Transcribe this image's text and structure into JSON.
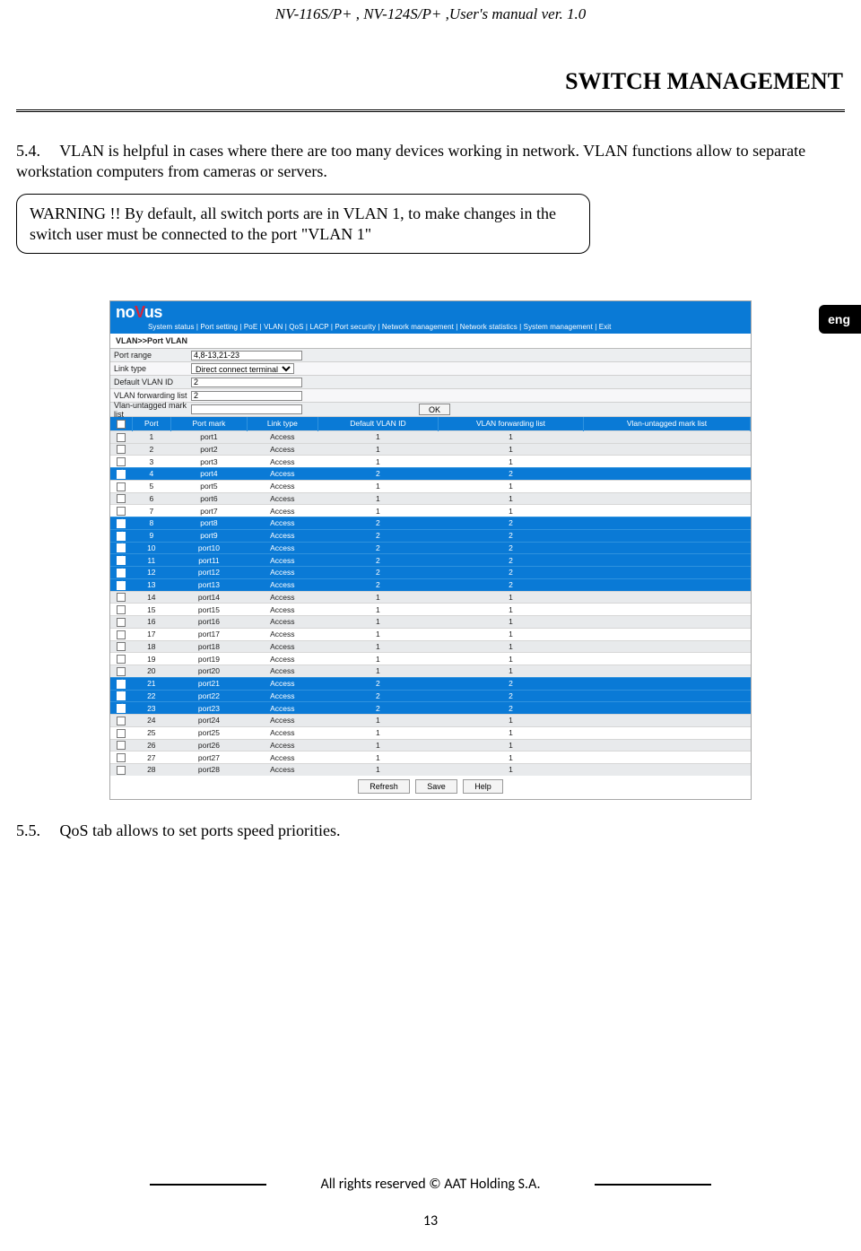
{
  "doc": {
    "header": "NV-116S/P+ , NV-124S/P+ ,User's manual ver. 1.0",
    "section_title": "SWITCH MANAGEMENT",
    "para54_num": "5.4.",
    "para54_text": "VLAN is helpful in cases where there are too many devices working in network. VLAN functions allow to separate workstation computers from cameras or servers.",
    "warning": "WARNING !! By default, all switch ports are in VLAN 1, to make changes in the switch user must be connected to the port \"VLAN 1\"",
    "para55_num": "5.5.",
    "para55_text": "QoS tab allows to set ports speed priorities.",
    "footer": "All rights reserved © AAT Holding S.A.",
    "page_num": "13"
  },
  "lang_tab": "eng",
  "ui": {
    "logo_no": "no",
    "logo_v": "V",
    "logo_us": "us",
    "menu": "System status | Port setting | PoE | VLAN | QoS | LACP | Port security | Network management | Network statistics | System management | Exit",
    "breadcrumb": "VLAN>>Port VLAN",
    "form": {
      "port_range_label": "Port range",
      "port_range_value": "4,8-13,21-23",
      "link_type_label": "Link type",
      "link_type_value": "Direct connect terminal",
      "default_vlan_id_label": "Default VLAN ID",
      "default_vlan_id_value": "2",
      "vlan_fwd_label": "VLAN forwarding list",
      "vlan_fwd_value": "2",
      "untagged_label": "Vlan-untagged mark list",
      "untagged_value": "",
      "ok": "OK"
    },
    "headers": {
      "chk": "",
      "port": "Port",
      "mark": "Port mark",
      "link": "Link type",
      "defvlan": "Default VLAN ID",
      "fwd": "VLAN forwarding list",
      "unt": "Vlan-untagged mark list"
    },
    "rows": [
      {
        "chk": false,
        "sel": false,
        "stripe": "gray",
        "port": "1",
        "mark": "port1",
        "link": "Access",
        "def": "1",
        "fwd": "1",
        "unt": ""
      },
      {
        "chk": false,
        "sel": false,
        "stripe": "gray",
        "port": "2",
        "mark": "port2",
        "link": "Access",
        "def": "1",
        "fwd": "1",
        "unt": ""
      },
      {
        "chk": false,
        "sel": false,
        "stripe": "white",
        "port": "3",
        "mark": "port3",
        "link": "Access",
        "def": "1",
        "fwd": "1",
        "unt": ""
      },
      {
        "chk": true,
        "sel": true,
        "stripe": "blue",
        "port": "4",
        "mark": "port4",
        "link": "Access",
        "def": "2",
        "fwd": "2",
        "unt": ""
      },
      {
        "chk": false,
        "sel": false,
        "stripe": "white",
        "port": "5",
        "mark": "port5",
        "link": "Access",
        "def": "1",
        "fwd": "1",
        "unt": ""
      },
      {
        "chk": false,
        "sel": false,
        "stripe": "gray",
        "port": "6",
        "mark": "port6",
        "link": "Access",
        "def": "1",
        "fwd": "1",
        "unt": ""
      },
      {
        "chk": false,
        "sel": false,
        "stripe": "white",
        "port": "7",
        "mark": "port7",
        "link": "Access",
        "def": "1",
        "fwd": "1",
        "unt": ""
      },
      {
        "chk": true,
        "sel": true,
        "stripe": "blue",
        "port": "8",
        "mark": "port8",
        "link": "Access",
        "def": "2",
        "fwd": "2",
        "unt": ""
      },
      {
        "chk": true,
        "sel": true,
        "stripe": "blue",
        "port": "9",
        "mark": "port9",
        "link": "Access",
        "def": "2",
        "fwd": "2",
        "unt": ""
      },
      {
        "chk": true,
        "sel": true,
        "stripe": "blue",
        "port": "10",
        "mark": "port10",
        "link": "Access",
        "def": "2",
        "fwd": "2",
        "unt": ""
      },
      {
        "chk": true,
        "sel": true,
        "stripe": "blue",
        "port": "11",
        "mark": "port11",
        "link": "Access",
        "def": "2",
        "fwd": "2",
        "unt": ""
      },
      {
        "chk": true,
        "sel": true,
        "stripe": "blue",
        "port": "12",
        "mark": "port12",
        "link": "Access",
        "def": "2",
        "fwd": "2",
        "unt": ""
      },
      {
        "chk": true,
        "sel": true,
        "stripe": "blue",
        "port": "13",
        "mark": "port13",
        "link": "Access",
        "def": "2",
        "fwd": "2",
        "unt": ""
      },
      {
        "chk": false,
        "sel": false,
        "stripe": "gray",
        "port": "14",
        "mark": "port14",
        "link": "Access",
        "def": "1",
        "fwd": "1",
        "unt": ""
      },
      {
        "chk": false,
        "sel": false,
        "stripe": "white",
        "port": "15",
        "mark": "port15",
        "link": "Access",
        "def": "1",
        "fwd": "1",
        "unt": ""
      },
      {
        "chk": false,
        "sel": false,
        "stripe": "gray",
        "port": "16",
        "mark": "port16",
        "link": "Access",
        "def": "1",
        "fwd": "1",
        "unt": ""
      },
      {
        "chk": false,
        "sel": false,
        "stripe": "white",
        "port": "17",
        "mark": "port17",
        "link": "Access",
        "def": "1",
        "fwd": "1",
        "unt": ""
      },
      {
        "chk": false,
        "sel": false,
        "stripe": "gray",
        "port": "18",
        "mark": "port18",
        "link": "Access",
        "def": "1",
        "fwd": "1",
        "unt": ""
      },
      {
        "chk": false,
        "sel": false,
        "stripe": "white",
        "port": "19",
        "mark": "port19",
        "link": "Access",
        "def": "1",
        "fwd": "1",
        "unt": ""
      },
      {
        "chk": false,
        "sel": false,
        "stripe": "gray",
        "port": "20",
        "mark": "port20",
        "link": "Access",
        "def": "1",
        "fwd": "1",
        "unt": ""
      },
      {
        "chk": true,
        "sel": true,
        "stripe": "blue",
        "port": "21",
        "mark": "port21",
        "link": "Access",
        "def": "2",
        "fwd": "2",
        "unt": ""
      },
      {
        "chk": true,
        "sel": true,
        "stripe": "blue",
        "port": "22",
        "mark": "port22",
        "link": "Access",
        "def": "2",
        "fwd": "2",
        "unt": ""
      },
      {
        "chk": true,
        "sel": true,
        "stripe": "blue",
        "port": "23",
        "mark": "port23",
        "link": "Access",
        "def": "2",
        "fwd": "2",
        "unt": ""
      },
      {
        "chk": false,
        "sel": false,
        "stripe": "gray",
        "port": "24",
        "mark": "port24",
        "link": "Access",
        "def": "1",
        "fwd": "1",
        "unt": ""
      },
      {
        "chk": false,
        "sel": false,
        "stripe": "white",
        "port": "25",
        "mark": "port25",
        "link": "Access",
        "def": "1",
        "fwd": "1",
        "unt": ""
      },
      {
        "chk": false,
        "sel": false,
        "stripe": "gray",
        "port": "26",
        "mark": "port26",
        "link": "Access",
        "def": "1",
        "fwd": "1",
        "unt": ""
      },
      {
        "chk": false,
        "sel": false,
        "stripe": "white",
        "port": "27",
        "mark": "port27",
        "link": "Access",
        "def": "1",
        "fwd": "1",
        "unt": ""
      },
      {
        "chk": false,
        "sel": false,
        "stripe": "gray",
        "port": "28",
        "mark": "port28",
        "link": "Access",
        "def": "1",
        "fwd": "1",
        "unt": ""
      }
    ],
    "buttons": {
      "refresh": "Refresh",
      "save": "Save",
      "help": "Help"
    }
  }
}
